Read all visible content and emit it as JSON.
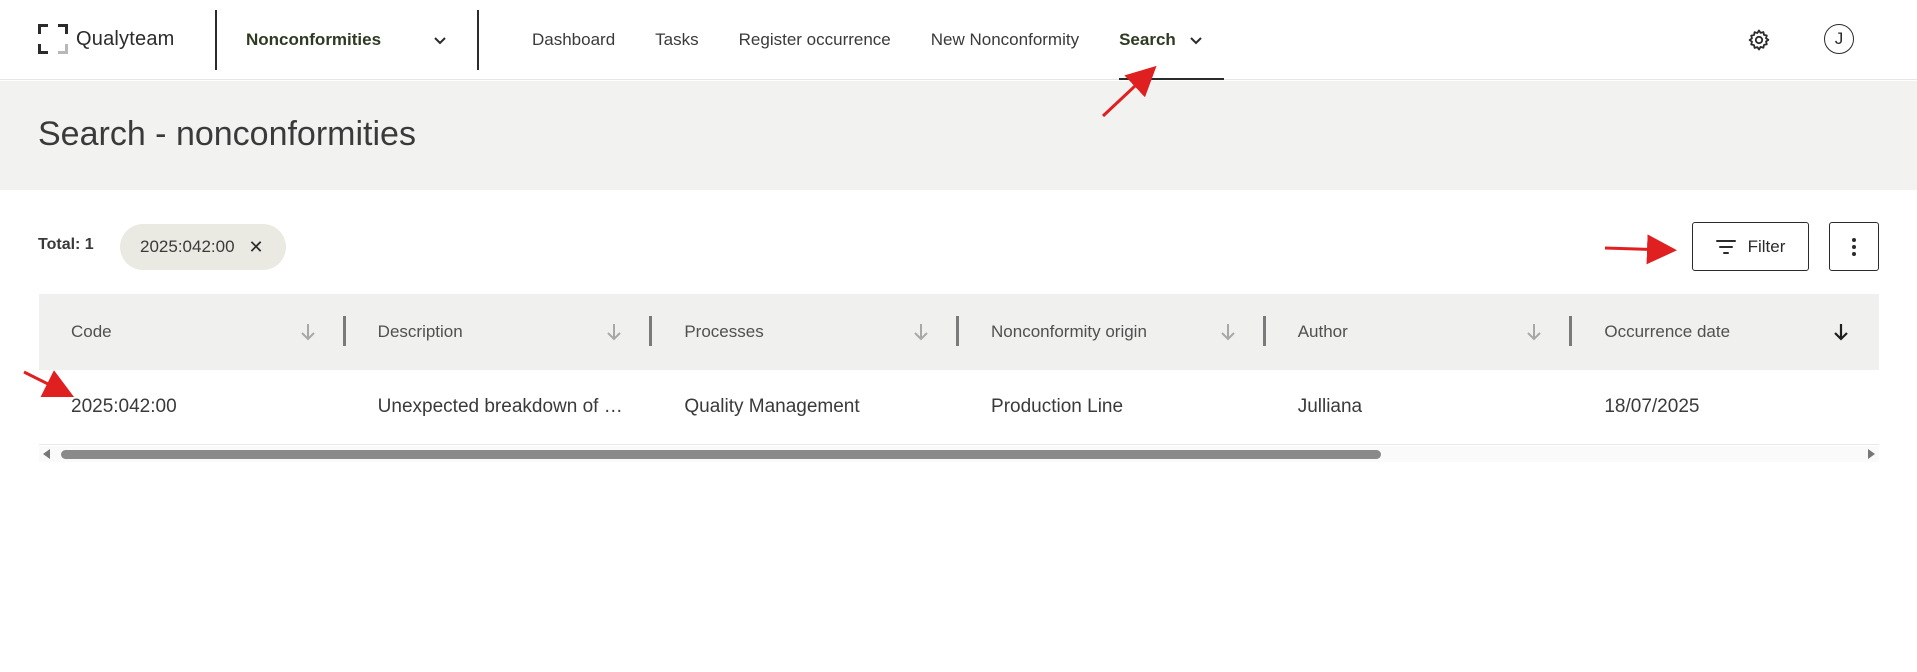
{
  "brand": {
    "name": "Qualyteam"
  },
  "module_selector": {
    "label": "Nonconformities"
  },
  "nav": {
    "items": [
      {
        "label": "Dashboard"
      },
      {
        "label": "Tasks"
      },
      {
        "label": "Register occurrence"
      },
      {
        "label": "New Nonconformity"
      },
      {
        "label": "Search",
        "active": true
      }
    ]
  },
  "user": {
    "initial": "J"
  },
  "page": {
    "title": "Search - nonconformities"
  },
  "toolbar": {
    "total_label": "Total: 1",
    "filter_chip": "2025:042:00",
    "filter_button": "Filter"
  },
  "table": {
    "columns": [
      {
        "label": "Code"
      },
      {
        "label": "Description"
      },
      {
        "label": "Processes"
      },
      {
        "label": "Nonconformity origin"
      },
      {
        "label": "Author"
      },
      {
        "label": "Occurrence date",
        "sorted": true
      }
    ],
    "rows": [
      {
        "code": "2025:042:00",
        "description": "Unexpected breakdown of …",
        "processes": "Quality Management",
        "origin": "Production Line",
        "author": "Julliana",
        "occurrence_date": "18/07/2025"
      }
    ]
  },
  "colors": {
    "accent_text": "#2e3a22",
    "header_band": "#f2f2f1",
    "chip_bg": "#eaeae3",
    "annotation_arrow": "#e02020"
  }
}
